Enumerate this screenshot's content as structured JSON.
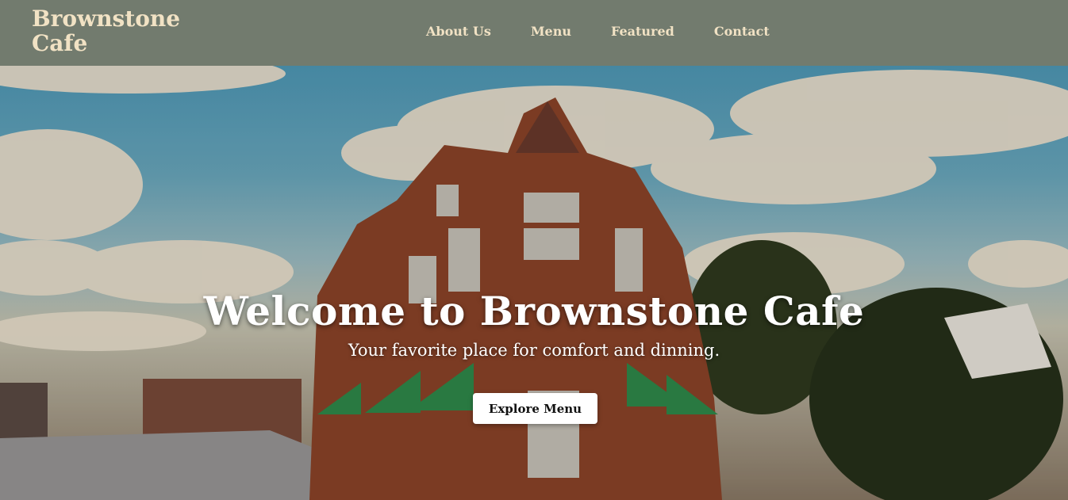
{
  "brand": {
    "name": "Brownstone Cafe"
  },
  "nav": {
    "items": [
      {
        "label": "About Us"
      },
      {
        "label": "Menu"
      },
      {
        "label": "Featured"
      },
      {
        "label": "Contact"
      }
    ]
  },
  "hero": {
    "title": "Welcome to Brownstone Cafe",
    "subtitle": "Your favorite place for comfort and dinning.",
    "cta_label": "Explore Menu"
  },
  "colors": {
    "navbar": "#727b6e",
    "brand_text": "#f1e2c4",
    "hero_text": "#ffffff",
    "button_bg": "#ffffff"
  }
}
